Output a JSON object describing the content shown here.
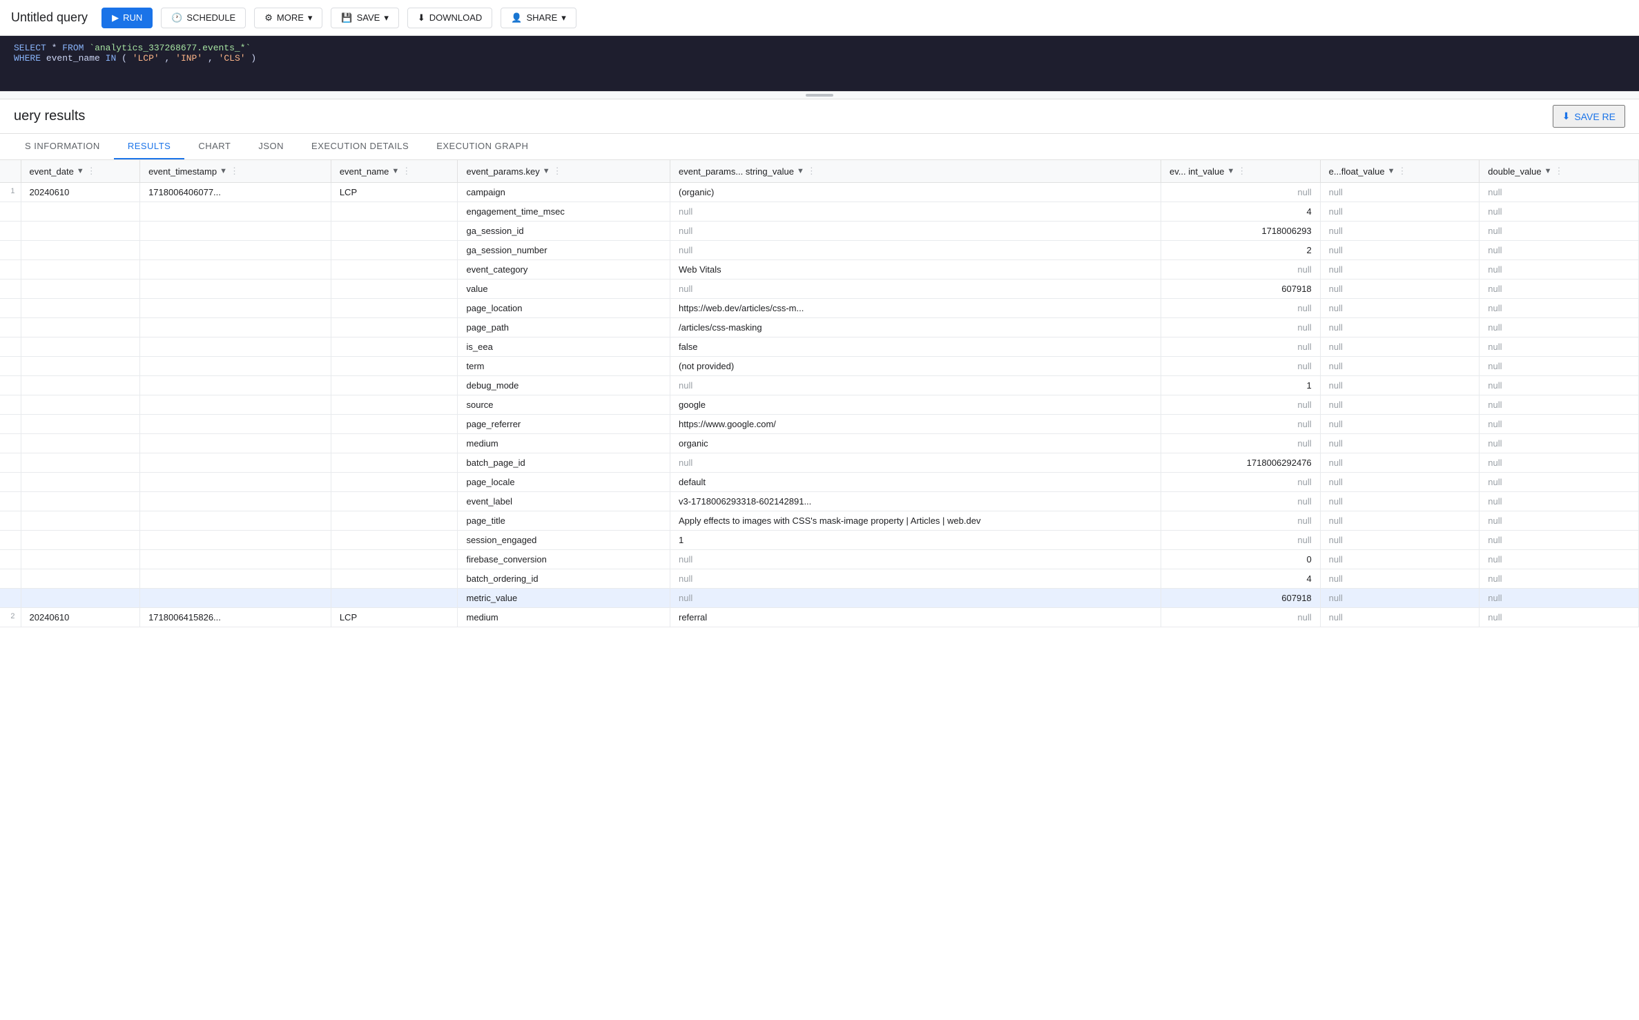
{
  "app": {
    "title": "Untitled query"
  },
  "toolbar": {
    "run_label": "RUN",
    "schedule_label": "SCHEDULE",
    "more_label": "MORE",
    "save_label": "SAVE",
    "download_label": "DOWNLOAD",
    "share_label": "SHARE",
    "save_results_label": "SAVE RE"
  },
  "sql": {
    "line1": "SELECT * FROM `analytics_337268677.events_*`",
    "line2": "WHERE event_name IN ('LCP', 'INP', 'CLS')"
  },
  "results": {
    "title": "uery results",
    "save_label": "SAVE RE"
  },
  "tabs": [
    {
      "id": "schema",
      "label": "S INFORMATION"
    },
    {
      "id": "results",
      "label": "RESULTS",
      "active": true
    },
    {
      "id": "chart",
      "label": "CHART"
    },
    {
      "id": "json",
      "label": "JSON"
    },
    {
      "id": "execution_details",
      "label": "EXECUTION DETAILS"
    },
    {
      "id": "execution_graph",
      "label": "EXECUTION GRAPH"
    }
  ],
  "columns": [
    {
      "id": "event_date",
      "label": "event_date",
      "sort": true
    },
    {
      "id": "event_timestamp",
      "label": "event_timestamp",
      "sort": true
    },
    {
      "id": "event_name",
      "label": "event_name",
      "sort": true
    },
    {
      "id": "event_params_key",
      "label": "event_params.key",
      "sort": true
    },
    {
      "id": "event_params_string_value",
      "label": "event_params... string_value",
      "sort": true
    },
    {
      "id": "ev_int_value",
      "label": "ev... int_value",
      "sort": true
    },
    {
      "id": "e_float_value",
      "label": "e...float_value",
      "sort": true
    },
    {
      "id": "double_value",
      "label": "double_value",
      "sort": true
    }
  ],
  "rows": [
    {
      "row_num": "1",
      "event_date": "20240610",
      "event_timestamp": "1718006406077...",
      "event_name": "LCP",
      "params": [
        {
          "key": "campaign",
          "string_value": "(organic)",
          "int_value": "null",
          "float_value": "null",
          "double_value": "null"
        },
        {
          "key": "engagement_time_msec",
          "string_value": "null",
          "int_value": "4",
          "float_value": "null",
          "double_value": "null"
        },
        {
          "key": "ga_session_id",
          "string_value": "null",
          "int_value": "1718006293",
          "float_value": "null",
          "double_value": "null"
        },
        {
          "key": "ga_session_number",
          "string_value": "null",
          "int_value": "2",
          "float_value": "null",
          "double_value": "null"
        },
        {
          "key": "event_category",
          "string_value": "Web Vitals",
          "int_value": "null",
          "float_value": "null",
          "double_value": "null"
        },
        {
          "key": "value",
          "string_value": "null",
          "int_value": "607918",
          "float_value": "null",
          "double_value": "null"
        },
        {
          "key": "page_location",
          "string_value": "https://web.dev/articles/css-m...",
          "int_value": "null",
          "float_value": "null",
          "double_value": "null"
        },
        {
          "key": "page_path",
          "string_value": "/articles/css-masking",
          "int_value": "null",
          "float_value": "null",
          "double_value": "null"
        },
        {
          "key": "is_eea",
          "string_value": "false",
          "int_value": "null",
          "float_value": "null",
          "double_value": "null"
        },
        {
          "key": "term",
          "string_value": "(not provided)",
          "int_value": "null",
          "float_value": "null",
          "double_value": "null"
        },
        {
          "key": "debug_mode",
          "string_value": "null",
          "int_value": "1",
          "float_value": "null",
          "double_value": "null"
        },
        {
          "key": "source",
          "string_value": "google",
          "int_value": "null",
          "float_value": "null",
          "double_value": "null"
        },
        {
          "key": "page_referrer",
          "string_value": "https://www.google.com/",
          "int_value": "null",
          "float_value": "null",
          "double_value": "null"
        },
        {
          "key": "medium",
          "string_value": "organic",
          "int_value": "null",
          "float_value": "null",
          "double_value": "null"
        },
        {
          "key": "batch_page_id",
          "string_value": "null",
          "int_value": "1718006292476",
          "float_value": "null",
          "double_value": "null"
        },
        {
          "key": "page_locale",
          "string_value": "default",
          "int_value": "null",
          "float_value": "null",
          "double_value": "null"
        },
        {
          "key": "event_label",
          "string_value": "v3-1718006293318-602142891...",
          "int_value": "null",
          "float_value": "null",
          "double_value": "null"
        },
        {
          "key": "page_title",
          "string_value": "Apply effects to images with\nCSS's mask-image property  |\nArticles | web.dev",
          "int_value": "null",
          "float_value": "null",
          "double_value": "null"
        },
        {
          "key": "session_engaged",
          "string_value": "1",
          "int_value": "null",
          "float_value": "null",
          "double_value": "null"
        },
        {
          "key": "firebase_conversion",
          "string_value": "null",
          "int_value": "0",
          "float_value": "null",
          "double_value": "null"
        },
        {
          "key": "batch_ordering_id",
          "string_value": "null",
          "int_value": "4",
          "float_value": "null",
          "double_value": "null"
        },
        {
          "key": "metric_value",
          "string_value": "null",
          "int_value": "607918",
          "float_value": "null",
          "double_value": "null",
          "highlight": true
        }
      ]
    },
    {
      "row_num": "2",
      "event_date": "20240610",
      "event_timestamp": "1718006415826...",
      "event_name": "LCP",
      "params": [
        {
          "key": "medium",
          "string_value": "referral",
          "int_value": "null",
          "float_value": "null",
          "double_value": "null"
        }
      ]
    }
  ]
}
